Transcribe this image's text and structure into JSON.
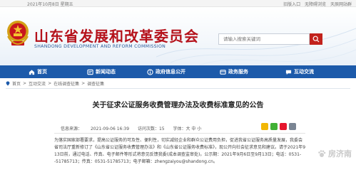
{
  "topbar": {
    "date": "2021年10月8日 星期五",
    "links": [
      "旧版入口",
      "无障碍浏览",
      "天辰网站群"
    ]
  },
  "header": {
    "title": "山东省发展和改革委员会",
    "subtitle": "SHANDONG DEVELOPMENT AND REFORM COMMISSION",
    "search_placeholder": "请输入搜索关键词"
  },
  "nav": {
    "items": [
      {
        "label": "首页",
        "icon": "home-icon"
      },
      {
        "label": "新闻动态",
        "icon": "news-icon"
      },
      {
        "label": "政府信息公开",
        "icon": "info-icon"
      },
      {
        "label": "政务服务",
        "icon": "service-icon"
      },
      {
        "label": "互动交流",
        "icon": "chat-icon"
      }
    ]
  },
  "breadcrumb": {
    "items": [
      "首页",
      "互动交流",
      "在线调查征集",
      "调查征集"
    ]
  },
  "article": {
    "title": "关于征求公证服务收费管理办法及收费标准意见的公告",
    "meta": {
      "source": "信息来源：",
      "date": "2021-09-06 16:39",
      "views": "访问次数：15",
      "font_size": "字体：大 中 小"
    },
    "body_lines": [
      "为落实国家部署要求，提高公证服务的可及性、便利性，切实减轻企业和群众公证费用负担，促进我省公证服务高质量发展，我委会",
      "省司法厅重新修订了《山东省公证服务收费管理办法》和《山东省公证服务收费标准》，现公开向社会征求意见和建议。请于2021年9月",
      "13日前，通过电话、传真、电子邮件等形式将意见反馈我委(成本调查监审处)。公示期：2021年9月6日至9月13日；电话：0531-",
      "-51785713；传真：0531-51785713；电子邮箱：zhengzaiyou@shandong.cn。"
    ]
  },
  "watermark": "房济南",
  "colors": {
    "brand_red": "#b5121b",
    "nav_blue": "#1c5aaa",
    "search_button": "#c2221c"
  }
}
